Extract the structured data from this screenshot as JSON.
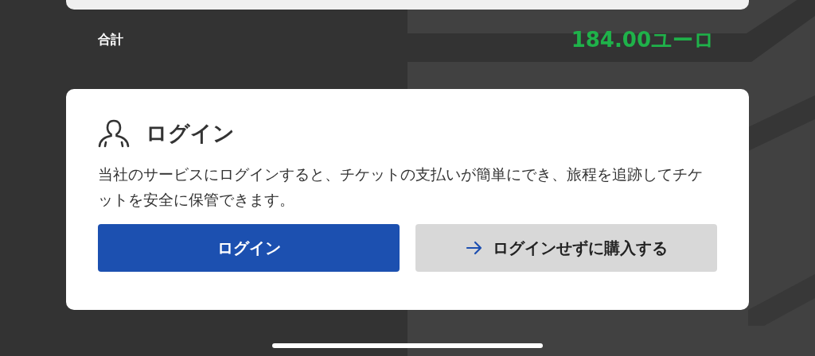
{
  "total": {
    "label": "合計",
    "amount": "184.00ユーロ"
  },
  "login_card": {
    "title": "ログイン",
    "description": "当社のサービスにログインすると、チケットの支払いが簡単にでき、旅程を追跡してチケットを安全に保管できます。",
    "buttons": [
      {
        "kind": "primary",
        "label": "ログイン"
      },
      {
        "kind": "secondary",
        "label": "ログインせずに購入する"
      }
    ]
  }
}
